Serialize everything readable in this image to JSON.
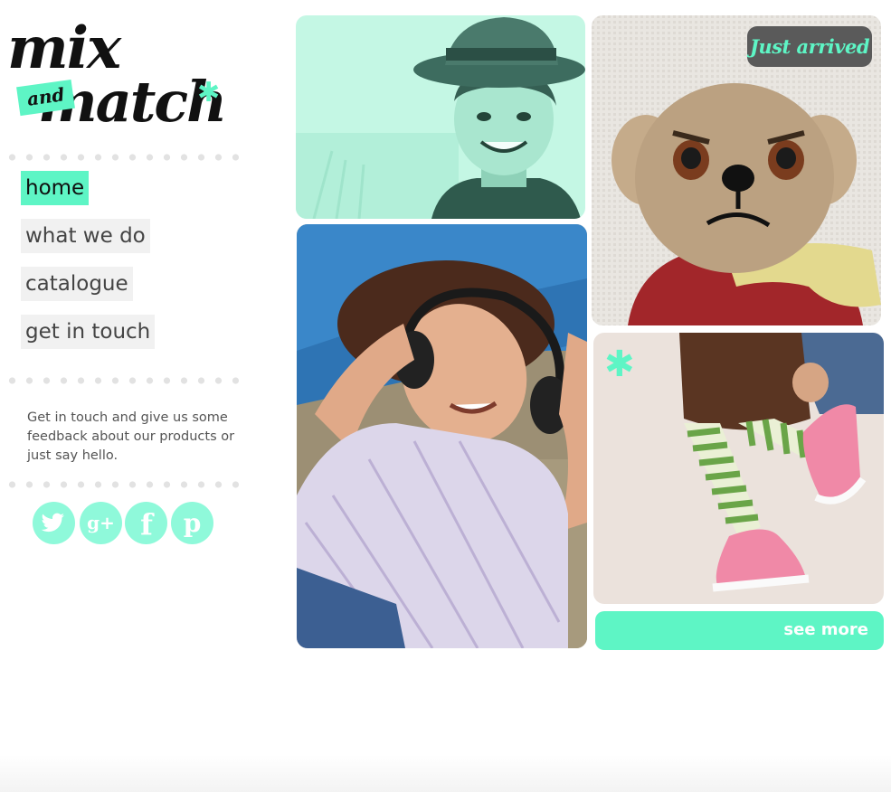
{
  "logo": {
    "word_top": "mix",
    "word_middle": "and",
    "word_bottom": "match",
    "star": "✱"
  },
  "nav": {
    "items": [
      {
        "label": "home",
        "active": true
      },
      {
        "label": "what we do",
        "active": false
      },
      {
        "label": "catalogue",
        "active": false
      },
      {
        "label": "get in touch",
        "active": false
      }
    ]
  },
  "blurb": "Get in touch and give us some feedback about our products or just say hello.",
  "social": [
    {
      "icon": "twitter-icon",
      "glyph": "t"
    },
    {
      "icon": "google-plus-icon",
      "glyph": "g+"
    },
    {
      "icon": "facebook-icon",
      "glyph": "f"
    },
    {
      "icon": "pinterest-icon",
      "glyph": "p"
    }
  ],
  "tiles": {
    "boy_hat": {
      "description_icon": "photo-boy-hat"
    },
    "teddy": {
      "badge": "Just arrived"
    },
    "girl_headphones": {
      "description_icon": "photo-girl-headphones"
    },
    "sneakers": {
      "star": "✱"
    }
  },
  "see_more": "see more",
  "colors": {
    "accent": "#5ef5c5",
    "accent_light": "#8ff9da",
    "nav_bg": "#f1f1f1",
    "text": "#444444",
    "badge_bg": "#5a5a5a"
  }
}
